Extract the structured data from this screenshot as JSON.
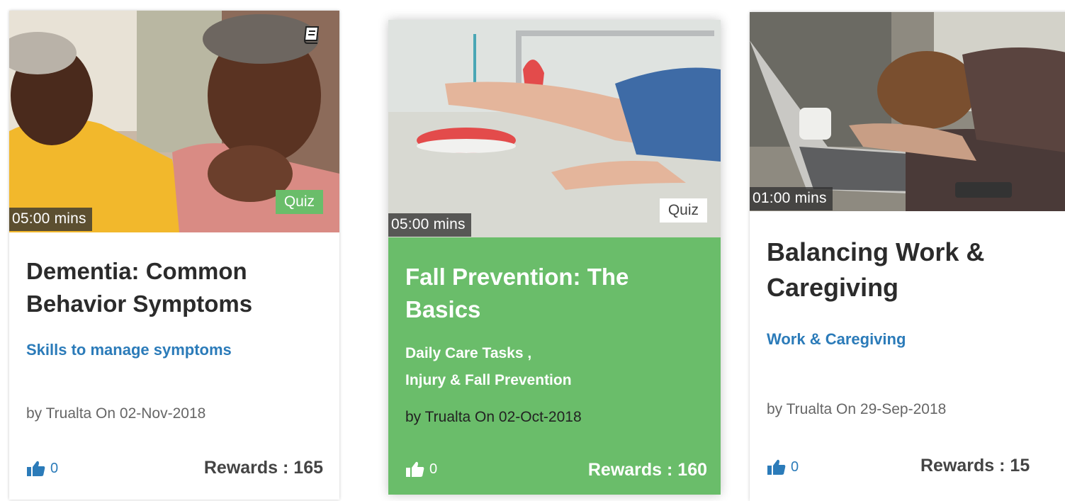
{
  "cards": [
    {
      "duration": "05:00 mins",
      "tag": "Quiz",
      "title": "Dementia: Common Behavior Symptoms",
      "category_lines": [
        "Skills to manage symptoms"
      ],
      "byline": "by Trualta On 02-Nov-2018",
      "likes": "0",
      "rewards": "Rewards : 165",
      "icons": [
        "book-icon",
        "thumbs-up-icon"
      ],
      "photo": "two-seniors-photo"
    },
    {
      "duration": "05:00 mins",
      "tag": "Quiz",
      "title": "Fall Prevention: The Basics",
      "category_lines": [
        "Daily Care Tasks ,",
        "Injury & Fall Prevention"
      ],
      "byline": "by Trualta On 02-Oct-2018",
      "likes": "0",
      "rewards": "Rewards : 160",
      "icons": [
        "thumbs-up-icon"
      ],
      "photo": "fallen-person-photo"
    },
    {
      "duration": "01:00 mins",
      "title": "Balancing Work & Caregiving",
      "category_lines": [
        "Work & Caregiving"
      ],
      "byline": "by Trualta On 29-Sep-2018",
      "likes": "0",
      "rewards": "Rewards : 15",
      "icons": [
        "thumbs-up-icon"
      ],
      "photo": "tired-worker-photo"
    }
  ],
  "colors": {
    "accent_green": "#6abd6a",
    "link_blue": "#2b7bb9",
    "title_dark": "#2b2b2b"
  }
}
